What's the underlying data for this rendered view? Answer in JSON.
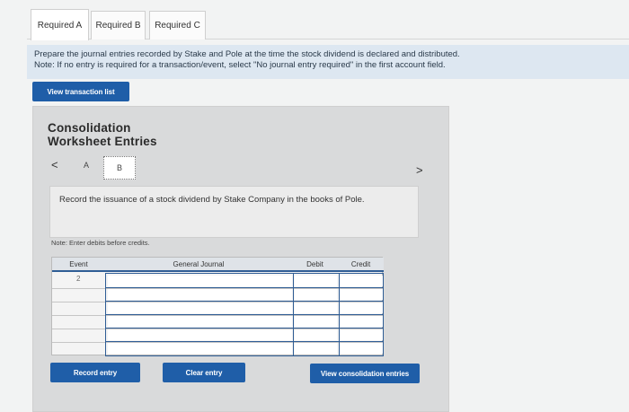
{
  "tabs": [
    {
      "label": "Required A"
    },
    {
      "label": "Required B"
    },
    {
      "label": "Required C"
    }
  ],
  "instructions": {
    "line1": "Prepare the journal entries recorded by Stake and Pole at the time the stock dividend is declared and distributed.",
    "line2": "Note: If no entry is required for a transaction/event, select \"No journal entry required\" in the first account field."
  },
  "view_transaction_label": "View transaction list",
  "panel": {
    "title_line1": "Consolidation",
    "title_line2": "Worksheet Entries",
    "prev_glyph": "<",
    "next_glyph": ">",
    "step_a": "A",
    "step_b": "B",
    "record_text": "Record the issuance of a stock dividend by Stake Company in the books of Pole.",
    "note": "Note: Enter debits before credits."
  },
  "table": {
    "headers": {
      "event": "Event",
      "journal": "General Journal",
      "debit": "Debit",
      "credit": "Credit"
    },
    "event_value": "2"
  },
  "buttons": {
    "record": "Record entry",
    "clear": "Clear entry",
    "view_consolidation": "View consolidation entries"
  },
  "colors": {
    "primary_button": "#1f5ea8",
    "instruction_bg": "#dde7f1",
    "grid_border": "#2f5d95"
  }
}
